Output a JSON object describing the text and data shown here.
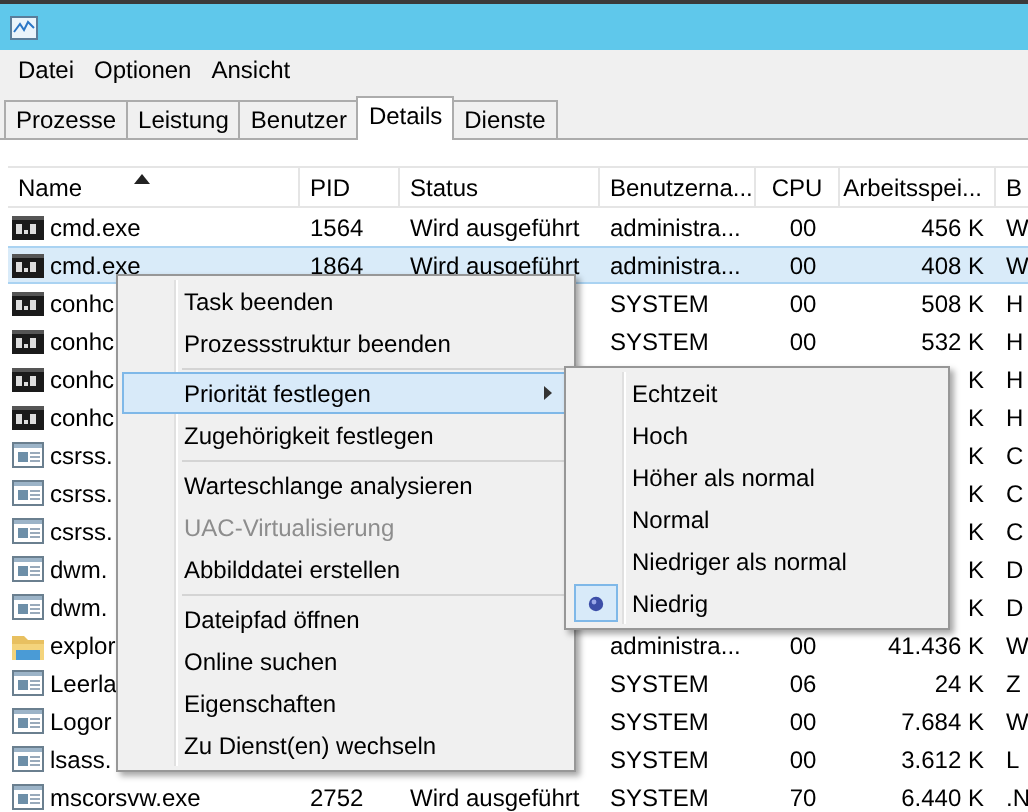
{
  "menu_bar": [
    "Datei",
    "Optionen",
    "Ansicht"
  ],
  "tabs": [
    {
      "label": "Prozesse",
      "selected": false
    },
    {
      "label": "Leistung",
      "selected": false
    },
    {
      "label": "Benutzer",
      "selected": false
    },
    {
      "label": "Details",
      "selected": true
    },
    {
      "label": "Dienste",
      "selected": false
    }
  ],
  "table": {
    "columns": [
      {
        "label": "Name",
        "sorted": true
      },
      {
        "label": "PID",
        "sorted": false
      },
      {
        "label": "Status",
        "sorted": false
      },
      {
        "label": "Benutzerna...",
        "sorted": false
      },
      {
        "label": "CPU",
        "sorted": false
      },
      {
        "label": "Arbeitsspei...",
        "sorted": false
      },
      {
        "label": "B",
        "sorted": false
      }
    ],
    "rows": [
      {
        "kind": "console",
        "selected": false,
        "cells": [
          "cmd.exe",
          "1564",
          "Wird ausgeführt",
          "administra...",
          "00",
          "456 K",
          "W"
        ]
      },
      {
        "kind": "console",
        "selected": true,
        "cells": [
          "cmd.exe",
          "1864",
          "Wird ausgeführt",
          "administra...",
          "00",
          "408 K",
          "W"
        ]
      },
      {
        "kind": "console",
        "selected": false,
        "cells": [
          "conhc",
          null,
          null,
          "SYSTEM",
          "00",
          "508 K",
          "H"
        ]
      },
      {
        "kind": "console",
        "selected": false,
        "cells": [
          "conhc",
          null,
          null,
          "SYSTEM",
          "00",
          "532 K",
          "H"
        ]
      },
      {
        "kind": "console",
        "selected": false,
        "cells": [
          "conhc",
          null,
          null,
          null,
          null,
          "K",
          "H"
        ]
      },
      {
        "kind": "console",
        "selected": false,
        "cells": [
          "conhc",
          null,
          null,
          null,
          null,
          "K",
          "H"
        ]
      },
      {
        "kind": "app",
        "selected": false,
        "cells": [
          "csrss.",
          null,
          null,
          null,
          null,
          "K",
          "C"
        ]
      },
      {
        "kind": "app",
        "selected": false,
        "cells": [
          "csrss.",
          null,
          null,
          null,
          null,
          "K",
          "C"
        ]
      },
      {
        "kind": "app",
        "selected": false,
        "cells": [
          "csrss.",
          null,
          null,
          null,
          null,
          "K",
          "C"
        ]
      },
      {
        "kind": "app",
        "selected": false,
        "cells": [
          "dwm.",
          null,
          null,
          null,
          null,
          "K",
          "D"
        ]
      },
      {
        "kind": "app",
        "selected": false,
        "cells": [
          "dwm.",
          null,
          null,
          null,
          null,
          "K",
          "D"
        ]
      },
      {
        "kind": "folder",
        "selected": false,
        "cells": [
          "explor",
          null,
          null,
          "administra...",
          "00",
          "41.436 K",
          "W"
        ]
      },
      {
        "kind": "app",
        "selected": false,
        "cells": [
          "Leerla",
          null,
          null,
          "SYSTEM",
          "06",
          "24 K",
          "Z"
        ]
      },
      {
        "kind": "app",
        "selected": false,
        "cells": [
          "Logor",
          null,
          null,
          "SYSTEM",
          "00",
          "7.684 K",
          "W"
        ]
      },
      {
        "kind": "app",
        "selected": false,
        "cells": [
          "lsass.",
          null,
          null,
          "SYSTEM",
          "00",
          "3.612 K",
          "L"
        ]
      },
      {
        "kind": "app",
        "selected": false,
        "cells": [
          "mscorsvw.exe",
          "2752",
          "Wird ausgeführt",
          "SYSTEM",
          "70",
          "6.440 K",
          ".N"
        ]
      }
    ]
  },
  "context_menu": {
    "items": [
      {
        "kind": "item",
        "label": "Task beenden",
        "selected": false,
        "disabled": false,
        "submenu": false
      },
      {
        "kind": "item",
        "label": "Prozessstruktur beenden",
        "selected": false,
        "disabled": false,
        "submenu": false
      },
      {
        "kind": "separator"
      },
      {
        "kind": "item",
        "label": "Priorität festlegen",
        "selected": true,
        "disabled": false,
        "submenu": true
      },
      {
        "kind": "item",
        "label": "Zugehörigkeit festlegen",
        "selected": false,
        "disabled": false,
        "submenu": false
      },
      {
        "kind": "separator"
      },
      {
        "kind": "item",
        "label": "Warteschlange analysieren",
        "selected": false,
        "disabled": false,
        "submenu": false
      },
      {
        "kind": "item",
        "label": "UAC-Virtualisierung",
        "selected": false,
        "disabled": true,
        "submenu": false
      },
      {
        "kind": "item",
        "label": "Abbilddatei erstellen",
        "selected": false,
        "disabled": false,
        "submenu": false
      },
      {
        "kind": "separator"
      },
      {
        "kind": "item",
        "label": "Dateipfad öffnen",
        "selected": false,
        "disabled": false,
        "submenu": false
      },
      {
        "kind": "item",
        "label": "Online suchen",
        "selected": false,
        "disabled": false,
        "submenu": false
      },
      {
        "kind": "item",
        "label": "Eigenschaften",
        "selected": false,
        "disabled": false,
        "submenu": false
      },
      {
        "kind": "item",
        "label": "Zu Dienst(en) wechseln",
        "selected": false,
        "disabled": false,
        "submenu": false
      }
    ]
  },
  "submenu": {
    "items": [
      {
        "label": "Echtzeit",
        "checked": false
      },
      {
        "label": "Hoch",
        "checked": false
      },
      {
        "label": "Höher als normal",
        "checked": false
      },
      {
        "label": "Normal",
        "checked": false
      },
      {
        "label": "Niedriger als normal",
        "checked": false
      },
      {
        "label": "Niedrig",
        "checked": true
      }
    ]
  }
}
